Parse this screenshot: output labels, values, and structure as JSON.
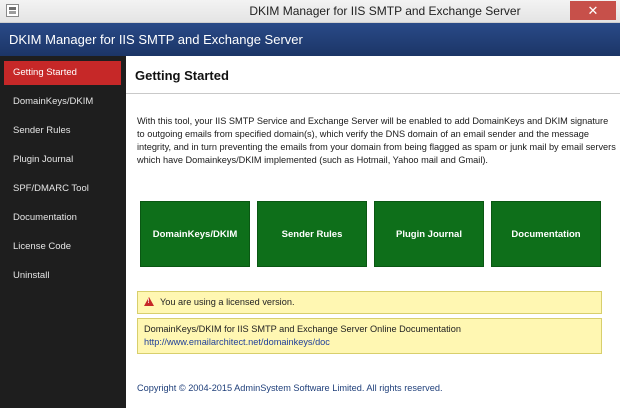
{
  "window": {
    "title": "DKIM Manager for IIS SMTP and Exchange Server",
    "close_glyph": "✕",
    "app_icon": "app-window-icon"
  },
  "header": {
    "title": "DKIM Manager for IIS SMTP and Exchange Server"
  },
  "sidebar": {
    "items": [
      {
        "label": "Getting Started",
        "active": true
      },
      {
        "label": "DomainKeys/DKIM",
        "active": false
      },
      {
        "label": "Sender Rules",
        "active": false
      },
      {
        "label": "Plugin Journal",
        "active": false
      },
      {
        "label": "SPF/DMARC Tool",
        "active": false
      },
      {
        "label": "Documentation",
        "active": false
      },
      {
        "label": "License Code",
        "active": false
      },
      {
        "label": "Uninstall",
        "active": false
      }
    ]
  },
  "main": {
    "title": "Getting Started",
    "intro": "With this tool, your IIS SMTP Service and Exchange Server will be enabled to add DomainKeys and DKIM signature to outgoing emails from specified domain(s), which verify the DNS domain of an email sender and the message integrity, and in turn preventing the emails from your domain from being flagged as spam or junk mail by email servers which have Domainkeys/DKIM implemented (such as Hotmail, Yahoo mail and Gmail).",
    "tiles": [
      {
        "label": "DomainKeys/DKIM"
      },
      {
        "label": "Sender Rules"
      },
      {
        "label": "Plugin Journal"
      },
      {
        "label": "Documentation"
      }
    ],
    "license_notice": "You are using a licensed version.",
    "doc_text": "DomainKeys/DKIM for IIS SMTP and Exchange Server Online Documentation",
    "doc_link": "http://www.emailarchitect.net/domainkeys/doc",
    "copyright": "Copyright © 2004-2015 AdminSystem Software Limited. All rights reserved."
  },
  "colors": {
    "header_blue": "#1c3566",
    "sidebar_bg": "#1e1e1e",
    "active_red": "#c62828",
    "tile_green": "#0e6f1a",
    "notice_yellow": "#fff7b2",
    "link_blue": "#1f3f9a"
  }
}
